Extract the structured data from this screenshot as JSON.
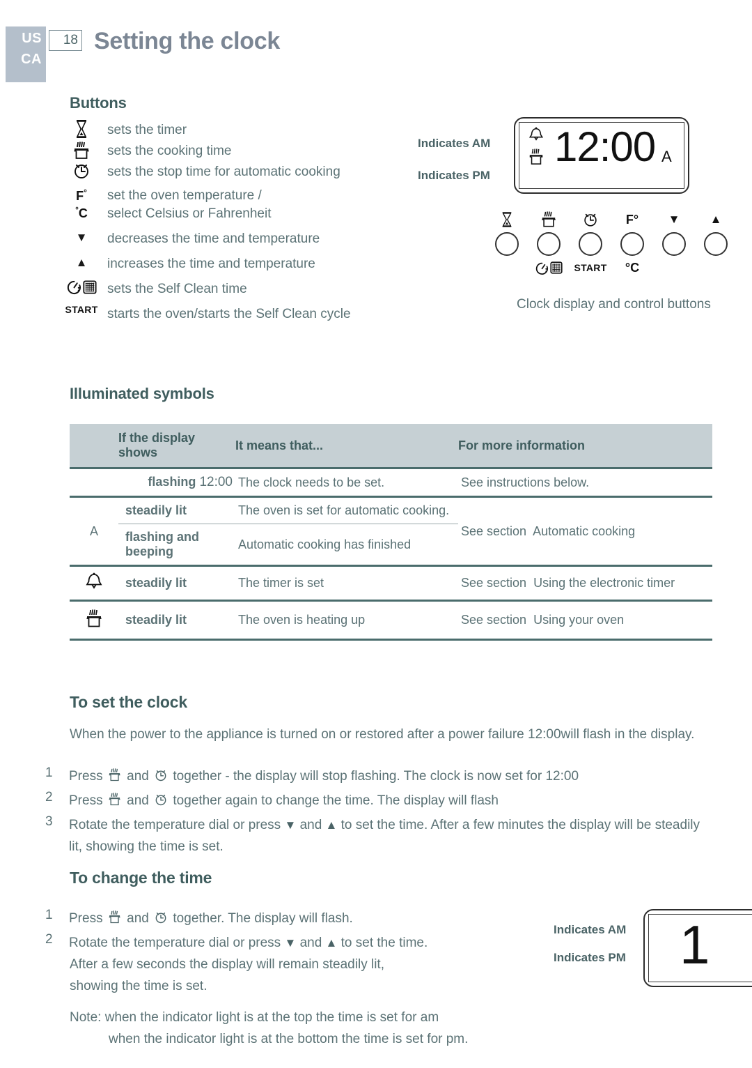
{
  "header": {
    "country_us": "US",
    "country_ca": "CA",
    "page_number": "18",
    "title": "Setting the clock"
  },
  "buttons_section": {
    "heading": "Buttons",
    "items": [
      {
        "icon": "hourglass-timer-icon",
        "text": "sets the timer"
      },
      {
        "icon": "oven-pot-icon",
        "text": "sets the cooking time"
      },
      {
        "icon": "alarm-clock-icon",
        "text": "sets the stop time for automatic cooking"
      },
      {
        "icon": "fahrenheit-celsius-icon",
        "text_line1": "set the oven temperature /",
        "text_line2": "select Celsius or Fahrenheit"
      },
      {
        "icon": "down-triangle-icon",
        "text": "decreases the time and temperature"
      },
      {
        "icon": "up-triangle-icon",
        "text": "increases the time and temperature"
      },
      {
        "icon": "self-clean-icon",
        "text": "sets the Self Clean time"
      },
      {
        "icon": "start-label-icon",
        "label": "START",
        "text": "starts the oven/starts the Self Clean cycle"
      }
    ]
  },
  "clock_diagram": {
    "am_label": "Indicates AM",
    "pm_label": "Indicates PM",
    "display_time": "12:00",
    "a_indicator": "A",
    "caption": "Clock display and control buttons",
    "button_symbols": [
      "hourglass-timer-icon",
      "oven-pot-icon",
      "alarm-clock-icon",
      "fahrenheit-icon",
      "down-triangle-icon",
      "up-triangle-icon"
    ],
    "fahrenheit_label": "F°",
    "celsius_label": "°C",
    "start_label": "START",
    "self_clean_icon": "self-clean-icon"
  },
  "illuminated_symbols": {
    "heading": "Illuminated symbols",
    "columns": [
      "If the display shows",
      "It means that...",
      "For more information"
    ],
    "rows": [
      {
        "symbol": "",
        "state": "flashing",
        "state_value": "12:00",
        "means": "The clock needs to be set.",
        "info": "See instructions below."
      },
      {
        "symbol": "A",
        "substates": [
          {
            "state": "steadily lit",
            "means": "The oven is set for automatic cooking."
          },
          {
            "state": "flashing and beeping",
            "means": "Automatic cooking has finished"
          }
        ],
        "info_prefix": "See section",
        "info_name": "Automatic cooking"
      },
      {
        "symbol": "bell-icon",
        "state": "steadily lit",
        "means": "The timer is set",
        "info_prefix": "See section",
        "info_name": "Using the electronic timer"
      },
      {
        "symbol": "oven-pot-icon",
        "state": "steadily lit",
        "means": "The oven is heating up",
        "info_prefix": "See section",
        "info_name": "Using your oven"
      }
    ]
  },
  "to_set_clock": {
    "heading": "To set the clock",
    "intro_part1": "When the power to the appliance is turned on or restored after a power failure",
    "intro_time": "12:00",
    "intro_part2": "will flash in the display.",
    "steps": [
      {
        "index": "1",
        "part1": "Press",
        "part2": "and",
        "part3": "together - the display will stop flashing. The clock is now set for 12:00"
      },
      {
        "index": "2",
        "part1": "Press",
        "part2": "and",
        "part3": "together again to change the time. The display will flash"
      },
      {
        "index": "3",
        "part1": "Rotate the temperature dial or press",
        "part2": "and",
        "part3": "to set the time. After a few minutes the display will be steadily lit, showing the time is set."
      }
    ]
  },
  "to_change_time": {
    "heading": "To change the time",
    "steps": [
      {
        "index": "1",
        "part1": "Press",
        "part2": "and",
        "part3": "together. The display will flash."
      },
      {
        "index": "2",
        "part1": "Rotate the temperature dial or press",
        "part2": "and",
        "part3": "to set the time."
      }
    ],
    "after_text_line1": "After a few seconds the display will remain steadily lit,",
    "after_text_line2": "showing the time is set.",
    "note_line1": "Note: when the indicator light is at the top the time is set for am",
    "note_line2": "when the indicator light is at the bottom the time is set for pm."
  },
  "bottom_diagram": {
    "am_label": "Indicates AM",
    "pm_label": "Indicates PM",
    "digit": "1"
  },
  "colors": {
    "country_block": "#b4bfcb",
    "title": "#7b8694",
    "heading": "#3f5d5e",
    "body_text": "#5b7275",
    "table_header_bg": "#c6d0d4",
    "rule": "#4a6c6c"
  }
}
